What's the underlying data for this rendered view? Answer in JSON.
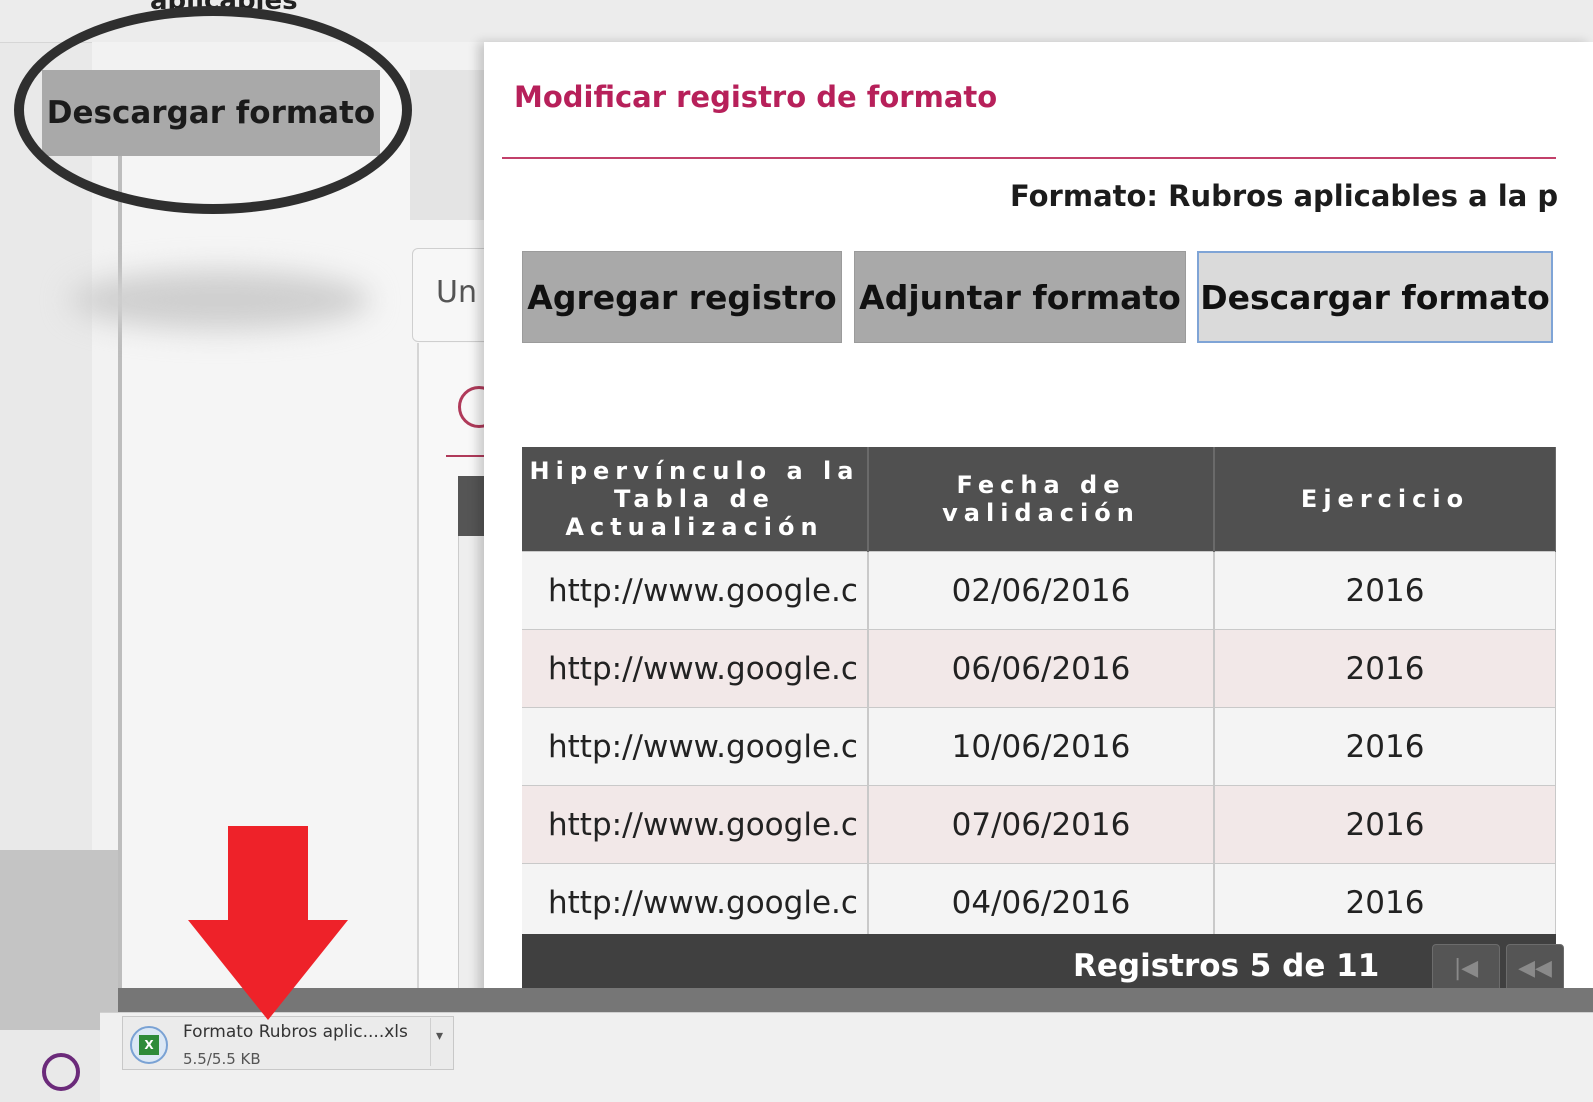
{
  "top": {
    "cut_text": "aplicables"
  },
  "background": {
    "tab_partial": "Un"
  },
  "left_button": {
    "label": "Descargar formato"
  },
  "modal": {
    "title": "Modificar registro de formato",
    "formato_label": "Formato: Rubros aplicables a la p",
    "buttons": {
      "agregar": "Agregar registro",
      "adjuntar": "Adjuntar formato",
      "descargar": "Descargar formato"
    },
    "table": {
      "headers": [
        "Hipervínculo a la Tabla de Actualización",
        "Fecha de validación",
        "Ejercicio"
      ],
      "rows": [
        [
          "http://www.google.c",
          "02/06/2016",
          "2016"
        ],
        [
          "http://www.google.c",
          "06/06/2016",
          "2016"
        ],
        [
          "http://www.google.c",
          "10/06/2016",
          "2016"
        ],
        [
          "http://www.google.c",
          "07/06/2016",
          "2016"
        ],
        [
          "http://www.google.c",
          "04/06/2016",
          "2016"
        ]
      ],
      "footer": "Registros 5 de 11",
      "pager": {
        "first": "|◀",
        "prev": "◀◀"
      }
    }
  },
  "download_bar": {
    "file_name": "Formato Rubros aplic....xls",
    "file_size": "5.5/5.5 KB",
    "caret": "▾",
    "icon": "excel-file-icon"
  },
  "colors": {
    "title": "#b7205a",
    "button_gray": "#a9a9a9",
    "header_dark": "#505050",
    "arrow_red": "#ee2229"
  }
}
